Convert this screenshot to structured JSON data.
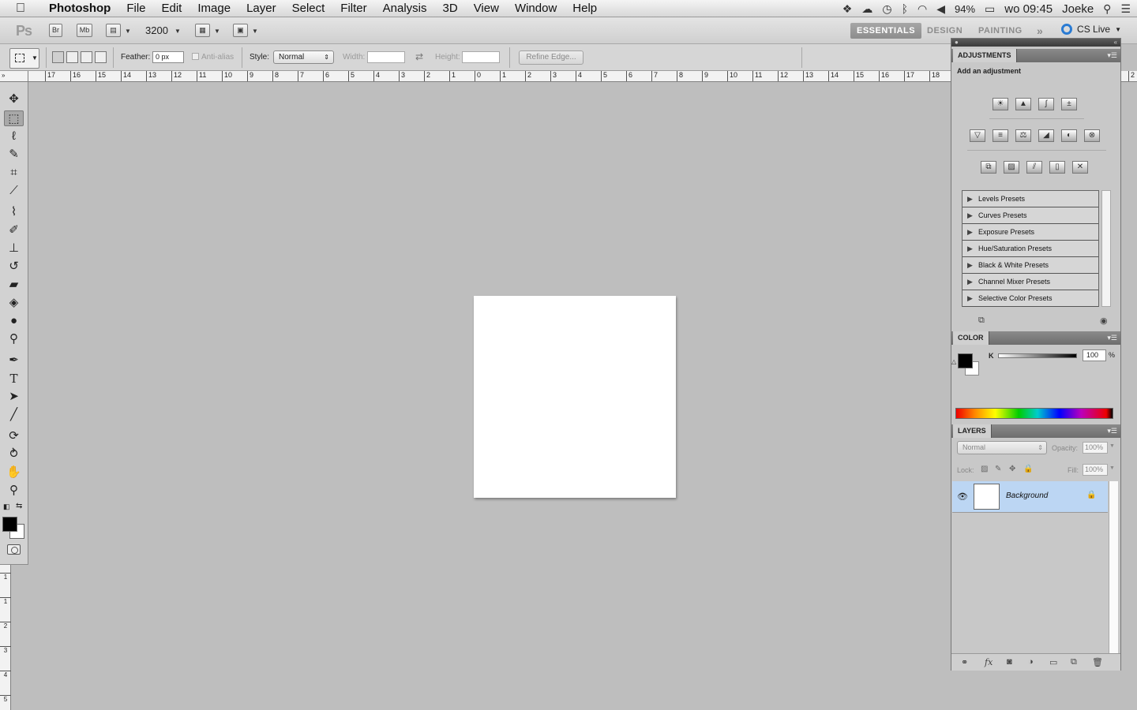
{
  "menubar": {
    "app": "Photoshop",
    "items": [
      "File",
      "Edit",
      "Image",
      "Layer",
      "Select",
      "Filter",
      "Analysis",
      "3D",
      "View",
      "Window",
      "Help"
    ],
    "battery": "94%",
    "clock": "wo 09:45",
    "user": "Joeke"
  },
  "appbar": {
    "logo": "Ps",
    "bridge_label": "Br",
    "minibridge_label": "Mb",
    "zoom": "3200",
    "workspaces": [
      "ESSENTIALS",
      "DESIGN",
      "PAINTING"
    ],
    "more": "»",
    "cslive": "CS Live"
  },
  "options": {
    "feather_label": "Feather:",
    "feather_value": "0 px",
    "antialias_label": "Anti-alias",
    "style_label": "Style:",
    "style_value": "Normal",
    "width_label": "Width:",
    "height_label": "Height:",
    "refine_label": "Refine Edge..."
  },
  "ruler": {
    "h_labels": [
      "17",
      "16",
      "15",
      "14",
      "13",
      "12",
      "11",
      "10",
      "9",
      "8",
      "7",
      "6",
      "5",
      "4",
      "3",
      "2",
      "1",
      "0",
      "1",
      "2",
      "3",
      "4",
      "5",
      "6",
      "7",
      "8",
      "9",
      "10",
      "11",
      "12",
      "13",
      "14",
      "15",
      "16",
      "17",
      "18"
    ],
    "h_tail": "2",
    "v_labels": [
      "1",
      "1",
      "2",
      "3",
      "4",
      "5"
    ]
  },
  "panels": {
    "adjustments": {
      "title": "ADJUSTMENTS",
      "subtitle": "Add an adjustment",
      "presets": [
        "Levels Presets",
        "Curves Presets",
        "Exposure Presets",
        "Hue/Saturation Presets",
        "Black & White Presets",
        "Channel Mixer Presets",
        "Selective Color Presets"
      ]
    },
    "color": {
      "title": "COLOR",
      "channel": "K",
      "value": "100",
      "unit": "%"
    },
    "layers": {
      "title": "LAYERS",
      "blend_mode": "Normal",
      "opacity_label": "Opacity:",
      "opacity_value": "100%",
      "lock_label": "Lock:",
      "fill_label": "Fill:",
      "fill_value": "100%",
      "layer_name": "Background"
    }
  },
  "colors": {
    "selected_layer": "#bcd6f3",
    "foreground": "#000000",
    "background": "#ffffff",
    "cslive_ring": "#2a7bd3"
  }
}
